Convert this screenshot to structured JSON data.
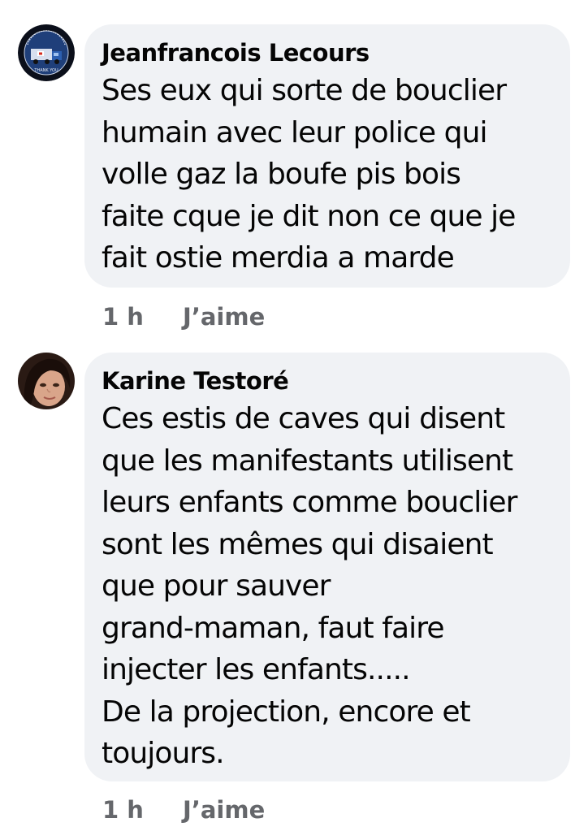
{
  "comments": [
    {
      "author": "Jeanfrancois Lecours",
      "avatar_icon": "trucker-convoy-badge-avatar",
      "avatar_badge_text": "THANK YOU",
      "text": "Ses eux qui sorte de bouclier\nhumain avec leur police qui\nvolle gaz la boufe pis bois\nfaite cque je dit non ce que je\nfait ostie merdia a marde",
      "time": "1 h",
      "like_label": "J’aime"
    },
    {
      "author": "Karine Testoré",
      "avatar_icon": "woman-portrait-avatar",
      "text": "Ces estis de caves qui disent\nque les manifestants utilisent\nleurs enfants comme bouclier\nsont les mêmes qui disaient\nque pour sauver\ngrand-maman, faut faire\ninjecter les enfants.....\nDe la projection, encore et\ntoujours.",
      "time": "1 h",
      "like_label": "J’aime"
    }
  ],
  "colors": {
    "bubble_bg": "#f0f2f5",
    "text": "#050505",
    "meta_text": "#65676b"
  }
}
